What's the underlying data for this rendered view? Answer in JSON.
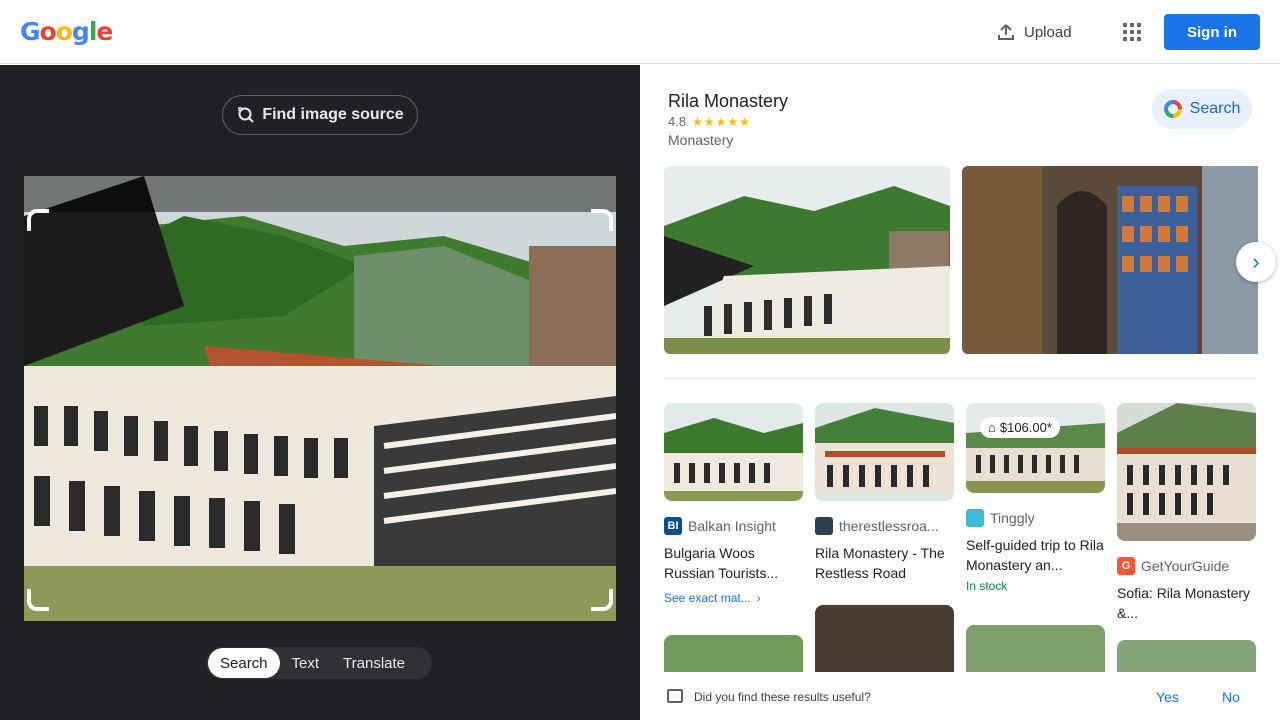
{
  "header": {
    "logo": "Google",
    "upload_label": "Upload",
    "signin_label": "Sign in"
  },
  "left": {
    "find_source_label": "Find image source",
    "tabs": [
      "Search",
      "Text",
      "Translate"
    ],
    "active_tab": "Search"
  },
  "knowledge_panel": {
    "title": "Rila Monastery",
    "rating": "4.8",
    "stars": "★★★★★",
    "type": "Monastery",
    "search_label": "Search"
  },
  "results": [
    {
      "source": "Balkan Insight",
      "favicon_text": "BI",
      "favicon_color": "#0b4f8a",
      "title": "Bulgaria Woos Russian Tourists...",
      "exact": "See exact mat..."
    },
    {
      "source": "therestlessroa...",
      "favicon_text": "",
      "favicon_color": "#2c3e50",
      "title": "Rila Monastery - The Restless Road"
    },
    {
      "source": "Tinggly",
      "favicon_text": "",
      "favicon_color": "#3dbcd6",
      "title": "Self-guided trip to Rila Monastery an...",
      "price": "$106.00*",
      "availability": "In stock"
    },
    {
      "source": "GetYourGuide",
      "favicon_text": "G",
      "favicon_color": "#ff5533",
      "title": "Sofia: Rila Monastery &..."
    }
  ],
  "feedback": {
    "question": "Did you find these results useful?",
    "yes": "Yes",
    "no": "No"
  },
  "colors": {
    "accent": "#1a73e8",
    "dark_panel": "#202124",
    "star": "#fbbc04"
  }
}
